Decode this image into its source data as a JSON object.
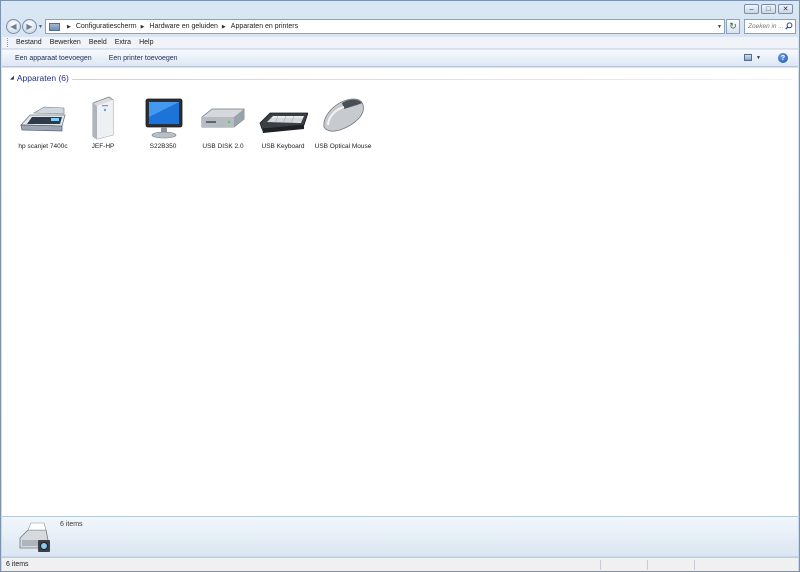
{
  "window": {
    "caption_buttons": [
      "minimize-icon",
      "maximize-icon",
      "close-icon"
    ]
  },
  "navigation": {
    "breadcrumbs": [
      "Configuratiescherm",
      "Hardware en geluiden",
      "Apparaten en printers"
    ],
    "search_placeholder": "Zoeken in ..."
  },
  "menu": {
    "items": [
      "Bestand",
      "Bewerken",
      "Beeld",
      "Extra",
      "Help"
    ]
  },
  "commands": {
    "add_device": "Een apparaat toevoegen",
    "add_printer": "Een printer toevoegen"
  },
  "group": {
    "title": "Apparaten (6)"
  },
  "devices": [
    {
      "label": "hp scanjet 7400c",
      "icon": "scanner-icon"
    },
    {
      "label": "JEF-HP",
      "icon": "computer-tower-icon"
    },
    {
      "label": "S22B350",
      "icon": "monitor-icon"
    },
    {
      "label": "USB DISK 2.0",
      "icon": "usb-drive-icon"
    },
    {
      "label": "USB Keyboard",
      "icon": "keyboard-icon"
    },
    {
      "label": "USB Optical Mouse",
      "icon": "mouse-icon"
    }
  ],
  "details": {
    "count": "6 items",
    "icon": "devices-and-printers-icon"
  },
  "status": {
    "text": "6 items"
  },
  "colors": {
    "group_title": "#1e3287",
    "command_text": "#1b2f54",
    "frame": "#d9e6f4"
  }
}
